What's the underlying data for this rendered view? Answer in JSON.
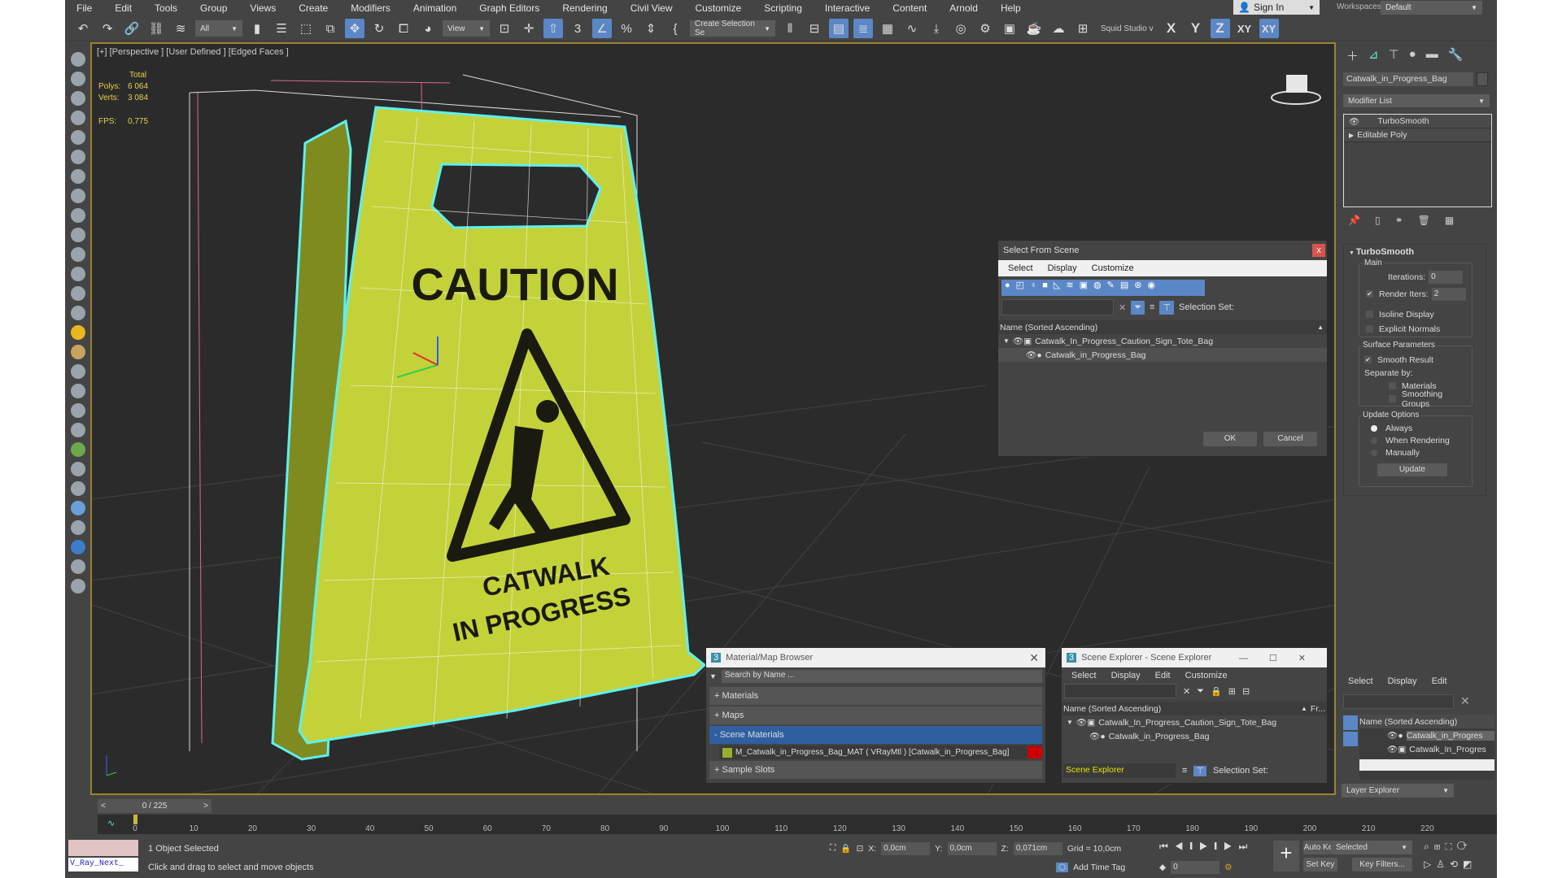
{
  "menu": [
    "File",
    "Edit",
    "Tools",
    "Group",
    "Views",
    "Create",
    "Modifiers",
    "Animation",
    "Graph Editors",
    "Rendering",
    "Civil View",
    "Customize",
    "Scripting",
    "Interactive",
    "Content",
    "Arnold",
    "Help"
  ],
  "signin": "Sign In",
  "workspaces_label": "Workspaces:",
  "workspace": "Default",
  "toolbar": {
    "filter": "All",
    "refcoord": "View",
    "selset": "Create Selection Se",
    "studio": "Squid Studio v",
    "axes": [
      "X",
      "Y",
      "Z",
      "XY",
      "XY"
    ]
  },
  "viewport": {
    "label": "[+] [Perspective ] [User Defined ] [Edged Faces ]",
    "stats": {
      "total": "Total",
      "polys_label": "Polys:",
      "polys": "6 064",
      "verts_label": "Verts:",
      "verts": "3 084",
      "fps_label": "FPS:",
      "fps": "0,775"
    },
    "sign": {
      "caution": "CAUTION",
      "line1": "CATWALK",
      "line2": "IN PROGRESS"
    }
  },
  "modify": {
    "object_name": "Catwalk_in_Progress_Bag",
    "modifier_list": "Modifier List",
    "stack": [
      "TurboSmooth",
      "Editable Poly"
    ],
    "rollout": "TurboSmooth",
    "main": "Main",
    "iterations_label": "Iterations:",
    "iterations": "0",
    "render_iters_label": "Render Iters:",
    "render_iters": "2",
    "isoline": "Isoline Display",
    "explicit": "Explicit Normals",
    "surface": "Surface Parameters",
    "smooth_result": "Smooth Result",
    "separate": "Separate by:",
    "materials": "Materials",
    "smoothing_groups": "Smoothing Groups",
    "update_options": "Update Options",
    "always": "Always",
    "when_rendering": "When Rendering",
    "manually": "Manually",
    "update": "Update"
  },
  "select_from_scene": {
    "title": "Select From Scene",
    "close": "x",
    "menu": [
      "Select",
      "Display",
      "Customize"
    ],
    "selection_set": "Selection Set:",
    "column": "Name (Sorted Ascending)",
    "items": [
      "Catwalk_In_Progress_Caution_Sign_Tote_Bag",
      "Catwalk_in_Progress_Bag"
    ],
    "ok": "OK",
    "cancel": "Cancel"
  },
  "material_browser": {
    "title": "Material/Map Browser",
    "search": "Search by Name ...",
    "sections": [
      "+ Materials",
      "+ Maps",
      "- Scene Materials",
      "+ Sample Slots"
    ],
    "material": "M_Catwalk_in_Progress_Bag_MAT ( VRayMtl ) [Catwalk_in_Progress_Bag]"
  },
  "scene_explorer": {
    "title": "Scene Explorer - Scene Explorer",
    "menu": [
      "Select",
      "Display",
      "Edit",
      "Customize"
    ],
    "column": "Name (Sorted Ascending)",
    "col2": "Fr...",
    "items": [
      "Catwalk_In_Progress_Caution_Sign_Tote_Bag",
      "Catwalk_in_Progress_Bag"
    ],
    "mode": "Scene Explorer",
    "selection_set": "Selection Set:"
  },
  "layer_explorer": {
    "menu": [
      "Select",
      "Display",
      "Edit"
    ],
    "column": "Name (Sorted Ascending)",
    "items": [
      "Catwalk_in_Progres",
      "Catwalk_In_Progres"
    ],
    "mode": "Layer Explorer"
  },
  "timeline": {
    "frame": "0 / 225",
    "ticks": [
      "0",
      "10",
      "20",
      "30",
      "40",
      "50",
      "60",
      "70",
      "80",
      "90",
      "100",
      "110",
      "120",
      "130",
      "140",
      "150",
      "160",
      "170",
      "180",
      "190",
      "200",
      "210",
      "220"
    ]
  },
  "status": {
    "script": "V_Ray_Next_",
    "selected": "1 Object Selected",
    "prompt": "Click and drag to select and move objects",
    "x_label": "X:",
    "x": "0,0cm",
    "y_label": "Y:",
    "y": "0,0cm",
    "z_label": "Z:",
    "z": "0,071cm",
    "grid": "Grid = 10,0cm",
    "add_time_tag": "Add Time Tag",
    "frame": "0",
    "auto_key": "Auto Key",
    "set_key": "Set Key",
    "key_mode": "Selected",
    "key_filters": "Key Filters..."
  }
}
